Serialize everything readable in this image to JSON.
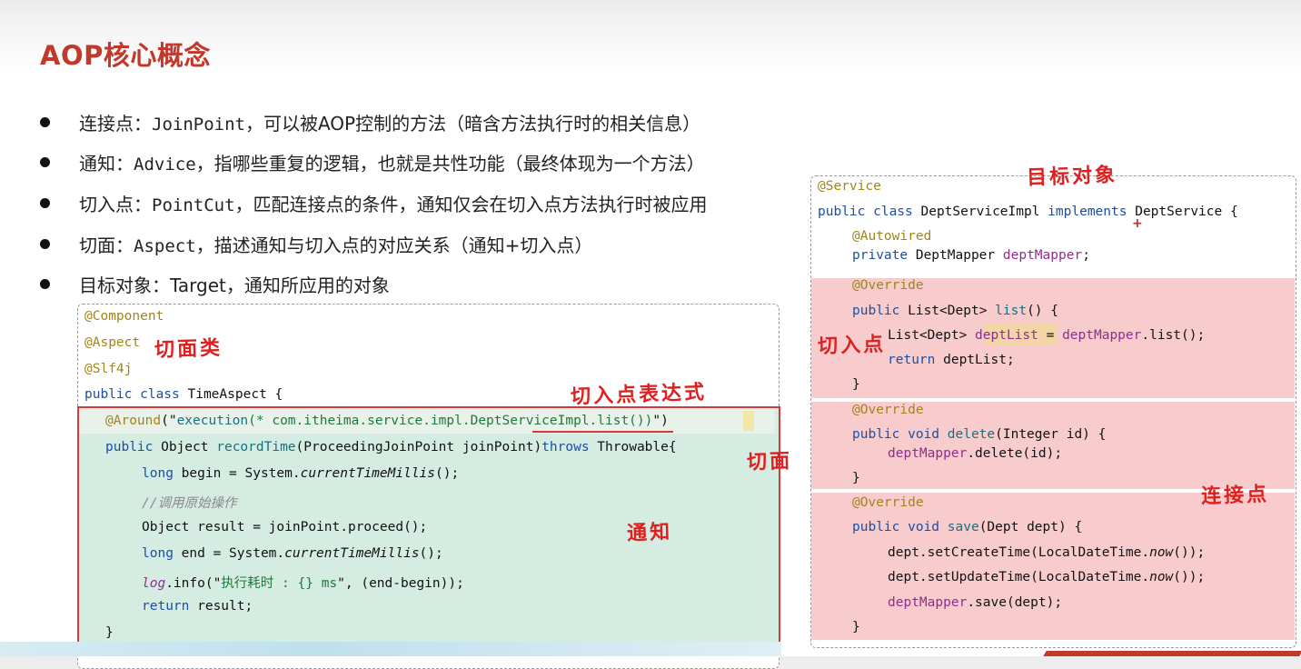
{
  "slide": {
    "title": "AOP核心概念",
    "bullets": [
      {
        "prefix": "连接点：",
        "code": "JoinPoint",
        "suffix": "，可以被AOP控制的方法（暗含方法执行时的相关信息）"
      },
      {
        "prefix": "通知：",
        "code": "Advice",
        "suffix": "，指哪些重复的逻辑，也就是共性功能（最终体现为一个方法）"
      },
      {
        "prefix": "切入点：",
        "code": "PointCut",
        "suffix": "，匹配连接点的条件，通知仅会在切入点方法执行时被应用"
      },
      {
        "prefix": "切面：",
        "code": "Aspect",
        "suffix": "，描述通知与切入点的对应关系（通知+切入点）"
      },
      {
        "prefix": "目标对象：",
        "code": "",
        "suffix": "Target，通知所应用的对象"
      }
    ]
  },
  "left_code": {
    "component": "@Component",
    "aspect": "@Aspect",
    "slf4j": "@Slf4j",
    "class_kw": "public class",
    "class_name": " TimeAspect {",
    "around_ann": "@Around",
    "around_open": "(\"",
    "around_exec": "execution",
    "around_expr": "(* com.itheima.service.impl.DeptServiceImpl.list())",
    "around_close": "\")",
    "method_kw": "public",
    "method_type": " Object ",
    "method_name": "recordTime",
    "method_params": "(ProceedingJoinPoint joinPoint)",
    "method_throws": "throws",
    "method_exc": " Throwable{",
    "begin_kw": "long",
    "begin_rest": " begin = System.",
    "begin_call": "currentTimeMillis",
    "begin_end": "();",
    "comment": "//调用原始操作",
    "proceed": "Object result = joinPoint.proceed();",
    "end_kw": "long",
    "end_rest": " end = System.",
    "end_call": "currentTimeMillis",
    "end_end": "();",
    "log_var": "log",
    "log_call": ".info(\"",
    "log_str": "执行耗时 : {} ms",
    "log_end": "\", (end-begin));",
    "return_kw": "return",
    "return_rest": " result;",
    "method_close": "}",
    "class_close": "}"
  },
  "right_code": {
    "service": "@Service",
    "public_class": "public class",
    "impl_name": " DeptServiceImpl ",
    "implements": "implements",
    "iface": " DeptService {",
    "autowired": "@Autowired",
    "private_kw": "private",
    "mapper_type": " DeptMapper ",
    "mapper_var": "deptMapper",
    "semi": ";",
    "override1": "@Override",
    "list_public": "public",
    "list_sig_a": " List<Dept> ",
    "list_name": "list",
    "list_sig_b": "() {",
    "list_body_a": "List<Dept> ",
    "list_body_var": "deptList",
    "list_body_b": " = ",
    "list_body_mapper": "deptMapper",
    "list_body_c": ".list();",
    "list_return_kw": "return",
    "list_return_rest": " deptList;",
    "close1": "}",
    "override2": "@Override",
    "del_public": "public void",
    "del_name": " delete",
    "del_sig": "(Integer id) {",
    "del_mapper": "deptMapper",
    "del_body": ".delete(id);",
    "close2": "}",
    "override3": "@Override",
    "save_public": "public void",
    "save_name": " save",
    "save_sig": "(Dept dept) {",
    "save_create_a": "dept.setCreateTime(LocalDateTime.",
    "save_now1": "now",
    "save_create_b": "());",
    "save_update_a": "dept.setUpdateTime(LocalDateTime.",
    "save_now2": "now",
    "save_update_b": "());",
    "save_mapper": "deptMapper",
    "save_body": ".save(dept);",
    "close3": "}"
  },
  "annotations": {
    "aspect_class": "切面类",
    "pointcut_expr": "切入点表达式",
    "aspect": "切面",
    "advice": "通知",
    "target": "目标对象",
    "pointcut": "切入点",
    "joinpoint": "连接点",
    "plus": "+"
  },
  "colors": {
    "title": "#c0392b",
    "annotation_red": "#e02020",
    "aspect_fill": "#d4ece1",
    "pink_fill": "#f8cccc"
  }
}
